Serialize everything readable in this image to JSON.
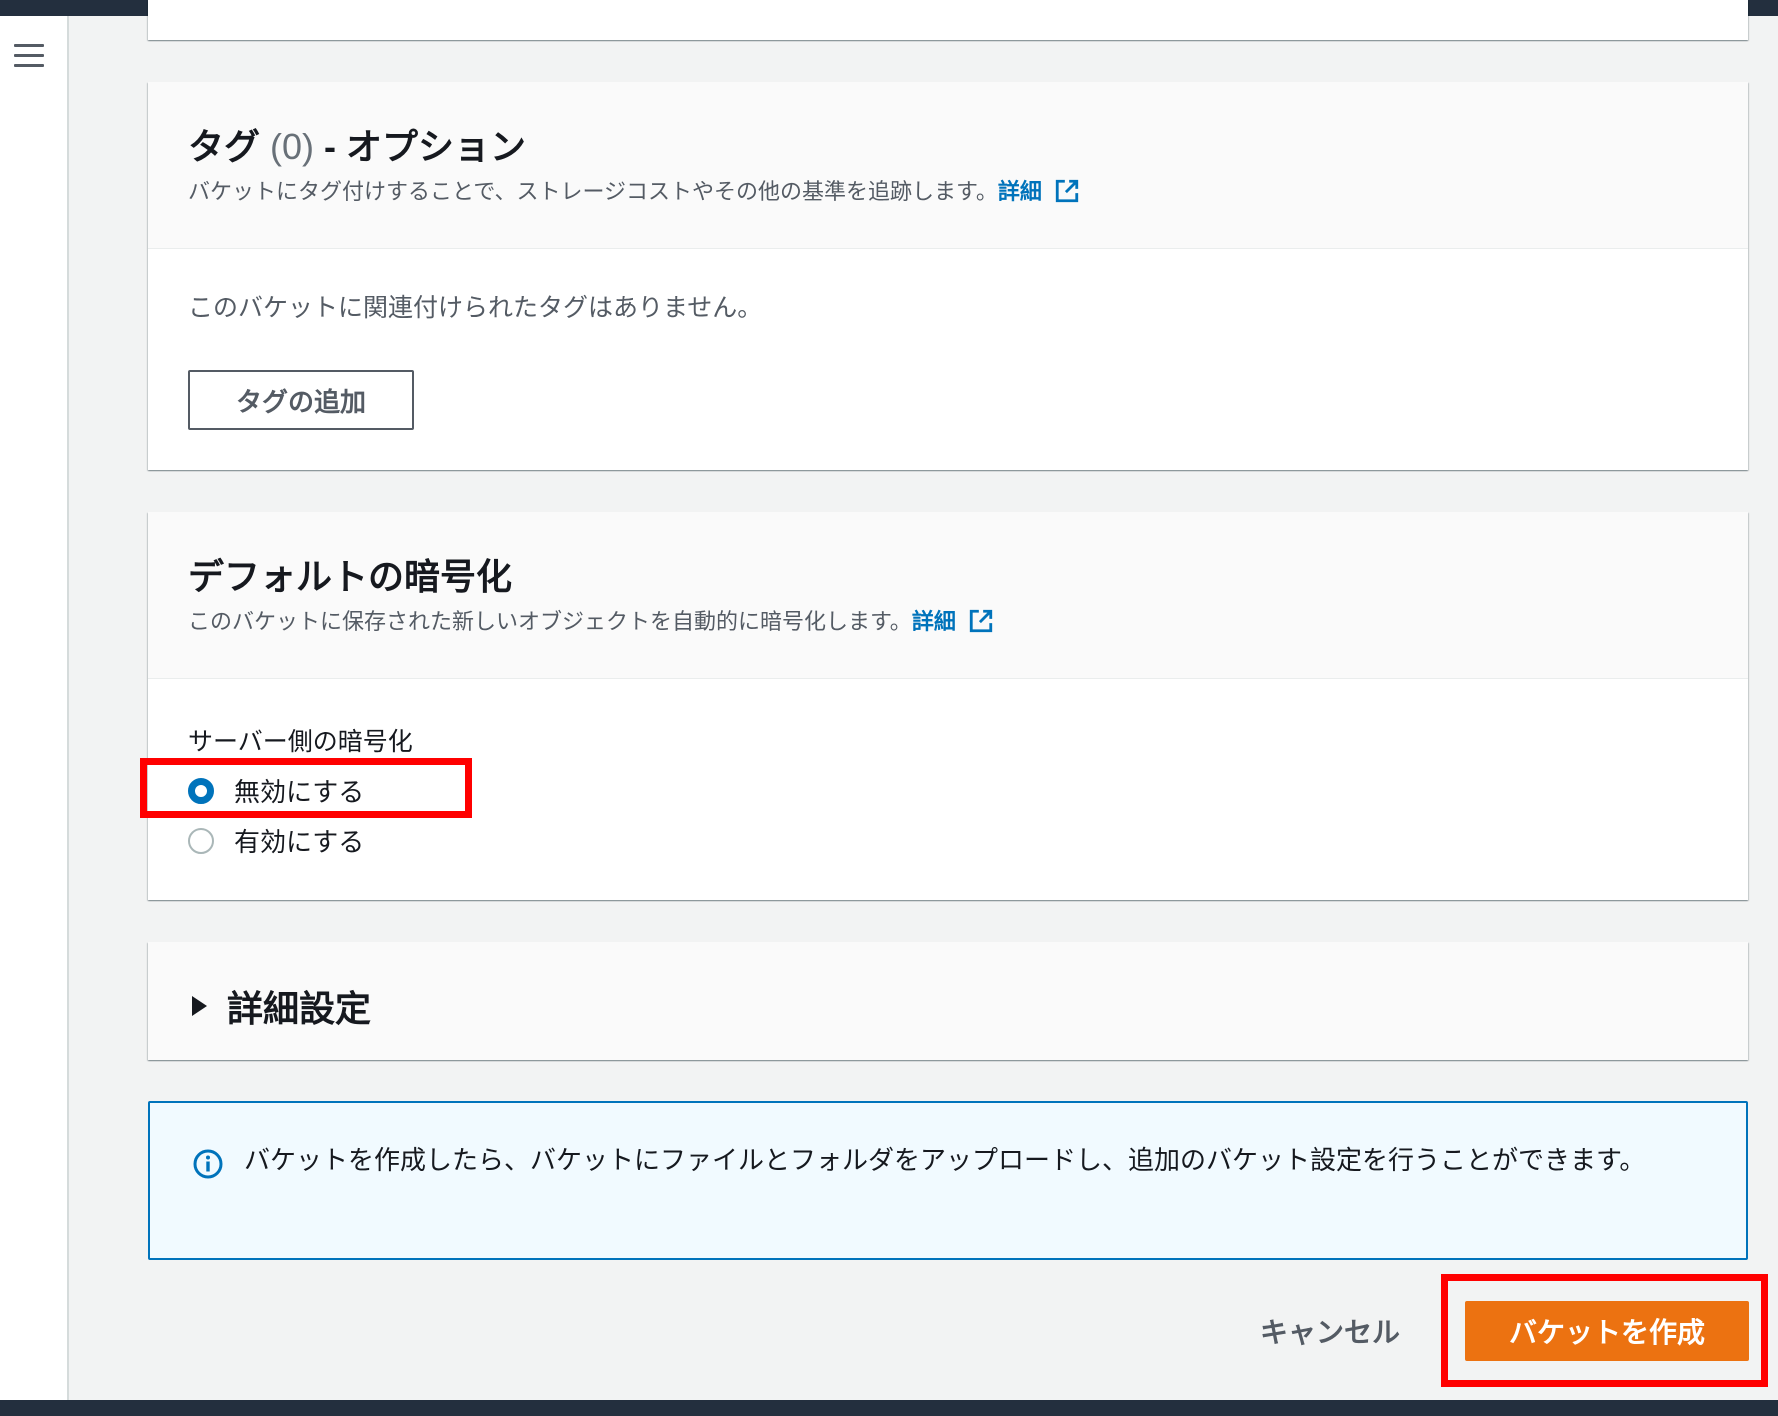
{
  "nav": {
    "menu_icon": "hamburger-menu-icon"
  },
  "tags": {
    "title_prefix": "タグ",
    "count": "(0)",
    "title_suffix": "- オプション",
    "description": "バケットにタグ付けすることで、ストレージコストやその他の基準を追跡します。",
    "details_link": "詳細",
    "empty_message": "このバケットに関連付けられたタグはありません。",
    "add_button": "タグの追加"
  },
  "encryption": {
    "title": "デフォルトの暗号化",
    "description": "このバケットに保存された新しいオブジェクトを自動的に暗号化します。",
    "details_link": "詳細",
    "field_label": "サーバー側の暗号化",
    "options": [
      {
        "label": "無効にする",
        "selected": true
      },
      {
        "label": "有効にする",
        "selected": false
      }
    ]
  },
  "advanced": {
    "label": "詳細設定",
    "expanded": false
  },
  "info": {
    "text": "バケットを作成したら、バケットにファイルとフォルダをアップロードし、追加のバケット設定を行うことができます。"
  },
  "footer": {
    "cancel_label": "キャンセル",
    "create_label": "バケットを作成"
  },
  "colors": {
    "primary": "#ec7211",
    "link": "#0073bb",
    "highlight": "#ff0000",
    "header": "#232f3e"
  }
}
